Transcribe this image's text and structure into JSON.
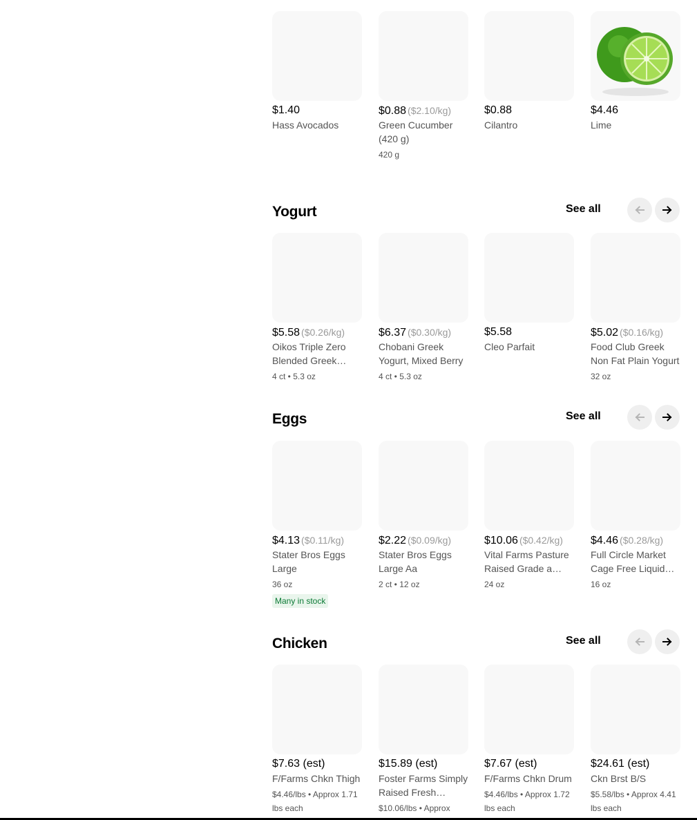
{
  "top_row": {
    "items": [
      {
        "price": "$1.40",
        "unit_price": "",
        "name": "Hass Avocados",
        "meta": "",
        "badge": ""
      },
      {
        "price": "$0.88",
        "unit_price": "($2.10/kg)",
        "name": "Green Cucumber (420 g)",
        "meta": "420 g",
        "badge": ""
      },
      {
        "price": "$0.88",
        "unit_price": "",
        "name": "Cilantro",
        "meta": "",
        "badge": ""
      },
      {
        "price": "$4.46",
        "unit_price": "",
        "name": "Lime",
        "meta": "",
        "badge": "",
        "image": "lime"
      }
    ]
  },
  "sections": [
    {
      "title": "Yogurt",
      "see_all": "See all",
      "items": [
        {
          "price": "$5.58",
          "unit_price": "($0.26/kg)",
          "name": "Oikos Triple Zero Blended Greek Yogurt",
          "meta": "4 ct • 5.3 oz",
          "badge": ""
        },
        {
          "price": "$6.37",
          "unit_price": "($0.30/kg)",
          "name": "Chobani Greek Yogurt, Mixed Berry",
          "meta": "4 ct • 5.3 oz",
          "badge": ""
        },
        {
          "price": "$5.58",
          "unit_price": "",
          "name": "Cleo Parfait",
          "meta": "",
          "badge": ""
        },
        {
          "price": "$5.02",
          "unit_price": "($0.16/kg)",
          "name": "Food Club Greek Non Fat Plain Yogurt",
          "meta": "32 oz",
          "badge": ""
        }
      ]
    },
    {
      "title": "Eggs",
      "see_all": "See all",
      "items": [
        {
          "price": "$4.13",
          "unit_price": "($0.11/kg)",
          "name": "Stater Bros Eggs Large",
          "meta": "36 oz",
          "badge": "Many in stock"
        },
        {
          "price": "$2.22",
          "unit_price": "($0.09/kg)",
          "name": "Stater Bros Eggs Large Aa",
          "meta": "2 ct • 12 oz",
          "badge": ""
        },
        {
          "price": "$10.06",
          "unit_price": "($0.42/kg)",
          "name": "Vital Farms Pasture Raised Grade a Large Eggs",
          "meta": "24 oz",
          "badge": ""
        },
        {
          "price": "$4.46",
          "unit_price": "($0.28/kg)",
          "name": "Full Circle Market Cage Free Liquid Egg Whites",
          "meta": "16 oz",
          "badge": ""
        }
      ]
    },
    {
      "title": "Chicken",
      "see_all": "See all",
      "items": [
        {
          "price": "$7.63 (est)",
          "unit_price": "",
          "name": "F/Farms Chkn Thigh",
          "meta": "$4.46/lbs • Approx 1.71 lbs each",
          "badge": ""
        },
        {
          "price": "$15.89 (est)",
          "unit_price": "",
          "name": "Foster Farms Simply Raised Fresh Chicken",
          "meta": "$10.06/lbs • Approx",
          "badge": ""
        },
        {
          "price": "$7.67 (est)",
          "unit_price": "",
          "name": "F/Farms Chkn Drum",
          "meta": "$4.46/lbs • Approx 1.72 lbs each",
          "badge": ""
        },
        {
          "price": "$24.61 (est)",
          "unit_price": "",
          "name": "Ckn Brst B/S",
          "meta": "$5.58/lbs • Approx 4.41 lbs each",
          "badge": ""
        }
      ]
    }
  ]
}
